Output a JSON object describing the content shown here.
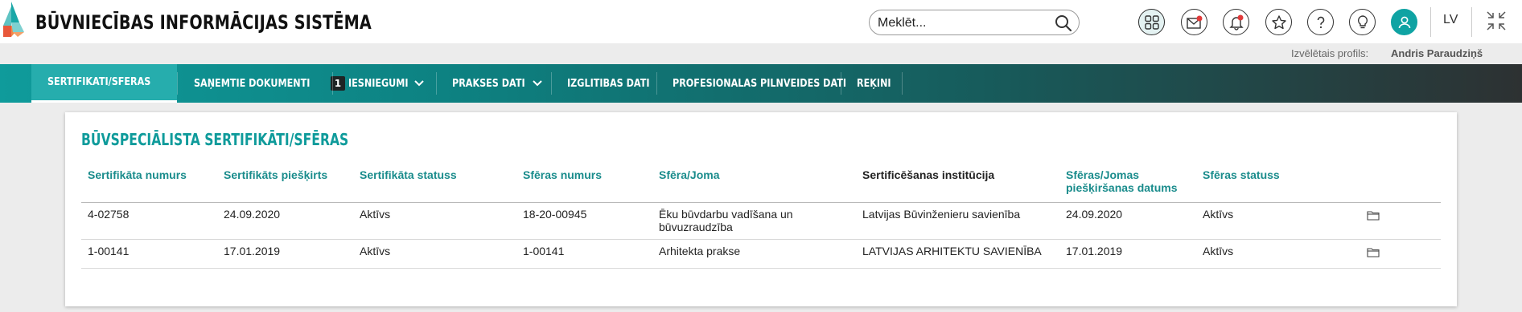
{
  "header": {
    "brand": "BŪVNIECĪBAS INFORMĀCIJAS SISTĒMA",
    "search_placeholder": "Meklēt...",
    "language": "LV",
    "icons": [
      "apps-icon",
      "messages-icon",
      "notifications-icon",
      "favorites-icon",
      "help-icon",
      "ideas-icon",
      "user-icon",
      "collapse-icon"
    ]
  },
  "profile": {
    "label": "Izvēlētais profils:",
    "name": "Andris Paraudziņš"
  },
  "nav": {
    "items": [
      {
        "label": "SERTIFIKĀTI/SFĒRAS"
      },
      {
        "label": "SAŅEMTIE DOKUMENTI",
        "badge": "1"
      },
      {
        "label": "IESNIEGUMI"
      },
      {
        "label": "PRAKSES DATI"
      },
      {
        "label": "IZGLĪTĪBAS DATI"
      },
      {
        "label": "PROFESIONĀLĀS PILNVEIDES DATI"
      },
      {
        "label": "RĒĶINI"
      }
    ]
  },
  "panel": {
    "title": "BŪVSPECIĀLISTA SERTIFIKĀTI/SFĒRAS",
    "columns": [
      "Sertifikāta numurs",
      "Sertifikāts piešķirts",
      "Sertifikāta statuss",
      "Sfēras numurs",
      "Sfēra/Joma",
      "Sertificēšanas institūcija",
      "Sfēras/Jomas piešķiršanas datums",
      "Sfēras statuss"
    ],
    "rows": [
      [
        "4-02758",
        "24.09.2020",
        "Aktīvs",
        "18-20-00945",
        "Ēku būvdarbu vadīšana un būvuzraudzība",
        "Latvijas Būvinženieru savienība",
        "24.09.2020",
        "Aktīvs"
      ],
      [
        "1-00141",
        "17.01.2019",
        "Aktīvs",
        "1-00141",
        "Arhitekta prakse",
        "LATVIJAS ARHITEKTU SAVIENĪBA",
        "17.01.2019",
        "Aktīvs"
      ]
    ]
  },
  "colors": {
    "accent": "#0f9b9b",
    "nav_dark": "#2d3132",
    "active_tab": "#26adad"
  }
}
